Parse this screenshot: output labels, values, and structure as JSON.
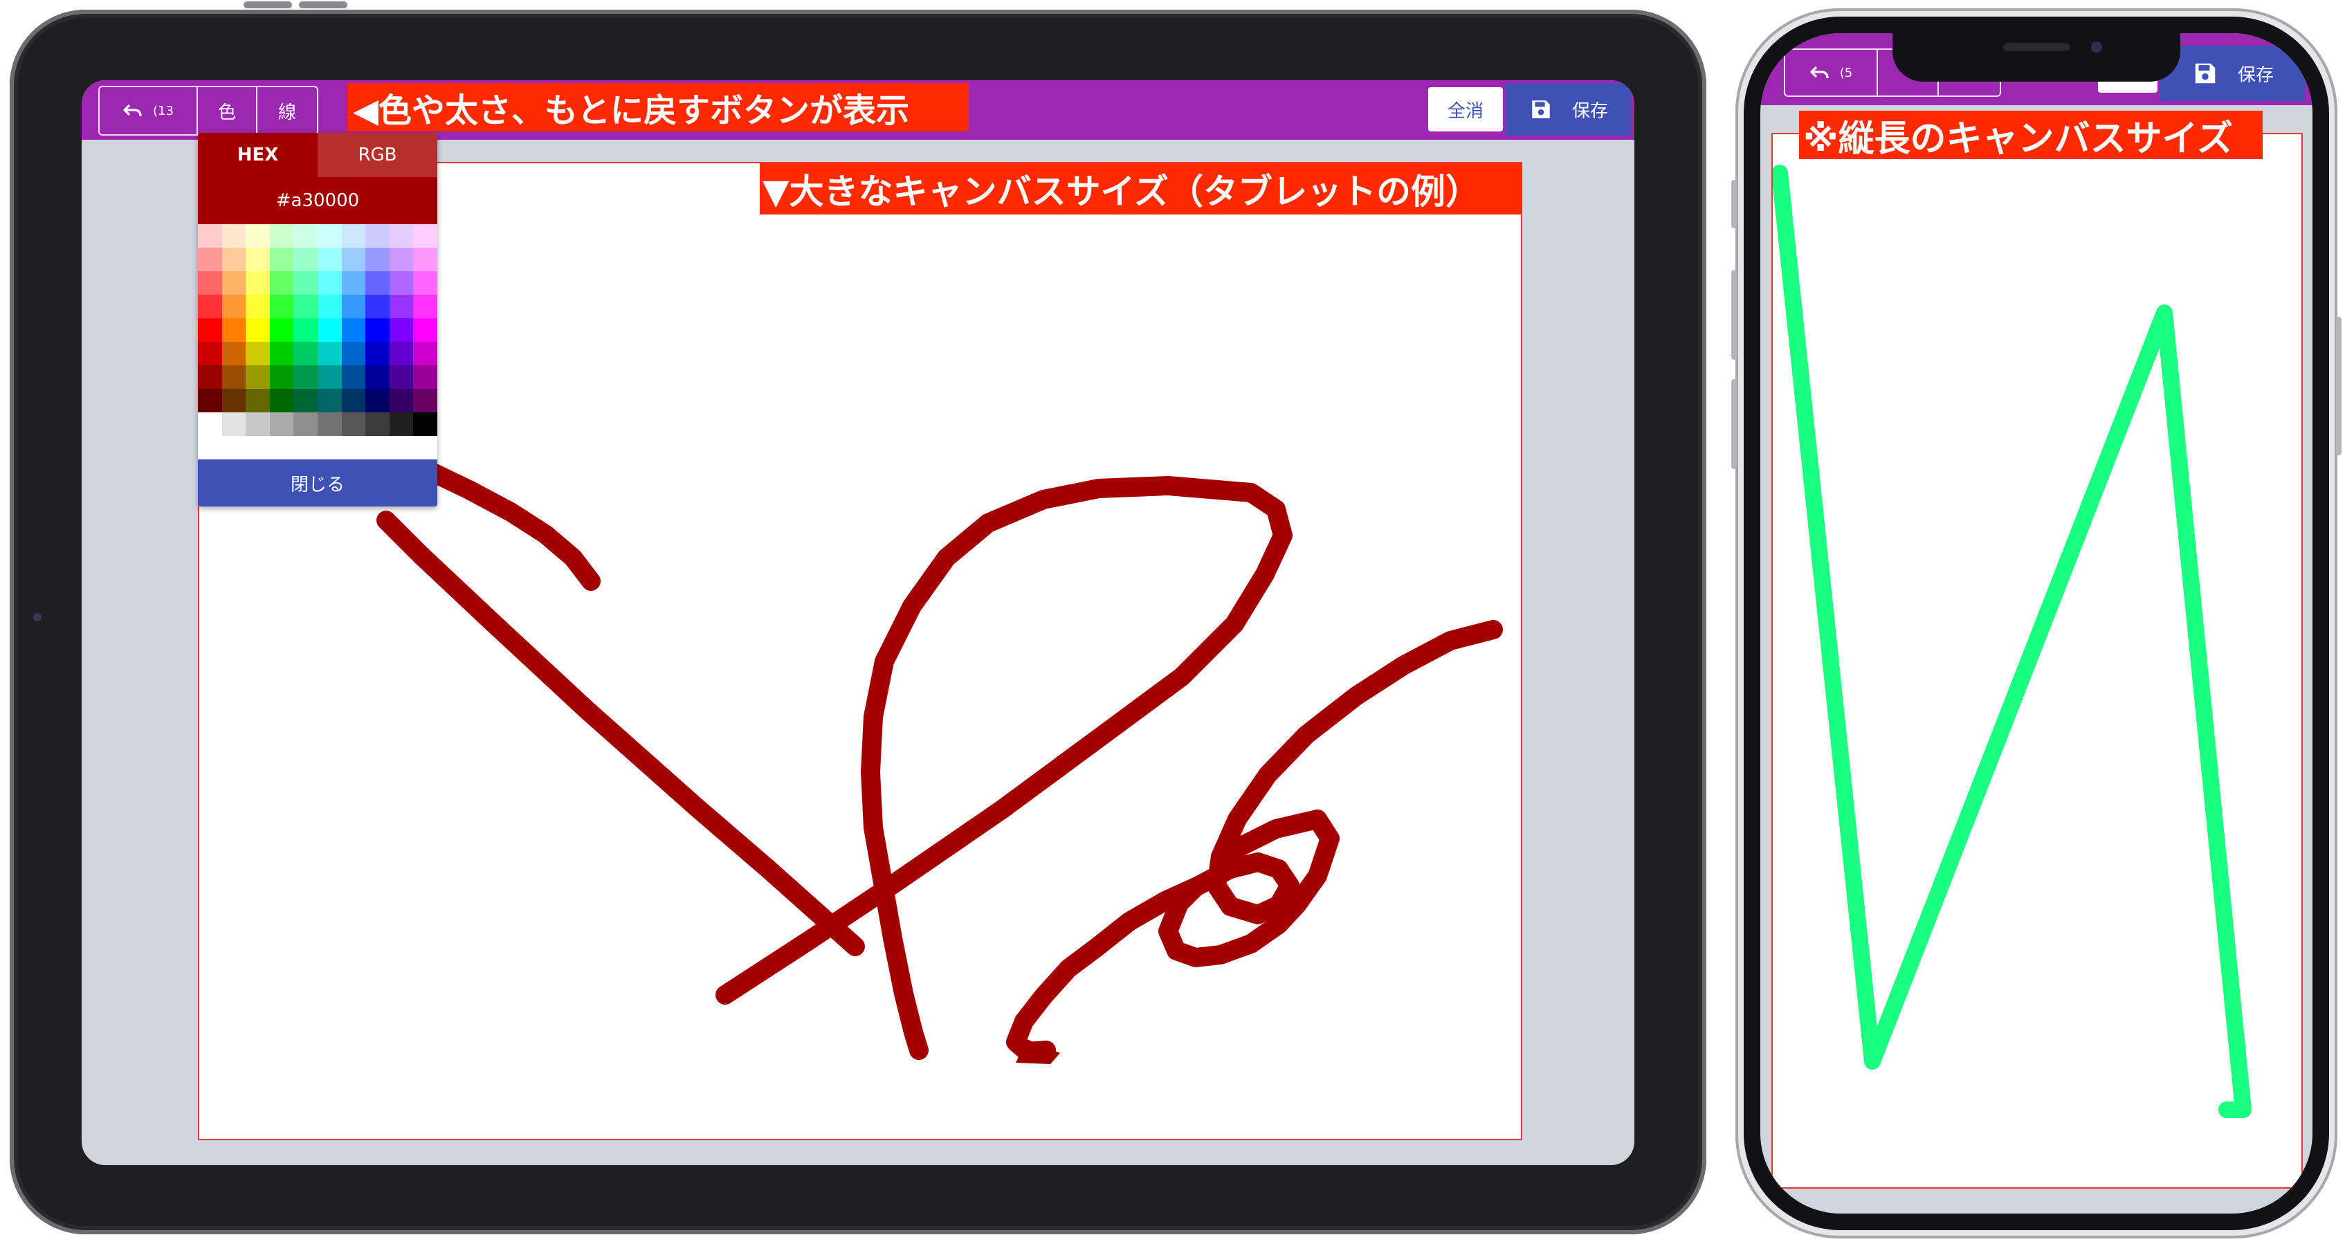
{
  "tablet": {
    "toolbar": {
      "undo_icon": "undo-icon",
      "undo_count": "(13",
      "color_label": "色",
      "line_label": "線",
      "clear_label": "全消",
      "save_icon": "floppy-disk-icon",
      "save_label": "保存"
    },
    "picker": {
      "tab_hex": "HEX",
      "tab_rgb": "RGB",
      "hex_value": "#a30000",
      "close_label": "閉じる"
    },
    "annotations": {
      "toolbar_note": "◀色や太さ、もとに戻すボタンが表示",
      "canvas_note": "▼大きなキャンバスサイズ（タブレットの例）"
    },
    "stroke_color": "#a30000"
  },
  "phone": {
    "toolbar": {
      "undo_icon": "undo-icon",
      "undo_count": "(5",
      "save_icon": "floppy-disk-icon",
      "save_label": "保存"
    },
    "annotations": {
      "canvas_note": "※縦長のキャンバスサイズ"
    },
    "stroke_color": "#1aff80"
  },
  "colors": {
    "toolbar_bg": "#9c27b0",
    "primary": "#3f51b5",
    "annotation_bg": "#ff2a00",
    "workspace_bg": "#ced5dd"
  }
}
